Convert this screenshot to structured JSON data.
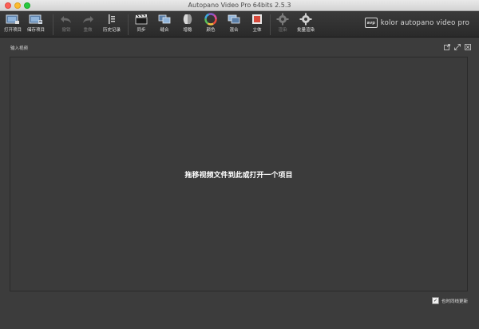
{
  "window": {
    "title": "Autopano Video Pro 64bits 2.5.3"
  },
  "toolbar": {
    "items": [
      {
        "id": "open",
        "label": "打开项目",
        "icon": "open-project-icon",
        "enabled": true
      },
      {
        "id": "save",
        "label": "储存项目",
        "icon": "save-project-icon",
        "enabled": true
      },
      {
        "id": "undo",
        "label": "撤销",
        "icon": "undo-icon",
        "enabled": false
      },
      {
        "id": "redo",
        "label": "重做",
        "icon": "redo-icon",
        "enabled": false
      },
      {
        "id": "history",
        "label": "历史记录",
        "icon": "history-icon",
        "enabled": true
      },
      {
        "id": "sync",
        "label": "同步",
        "icon": "clapper-icon",
        "enabled": true
      },
      {
        "id": "stitch",
        "label": "缝合",
        "icon": "stitch-icon",
        "enabled": true
      },
      {
        "id": "stabilize",
        "label": "增稳",
        "icon": "stabilize-icon",
        "enabled": true
      },
      {
        "id": "color",
        "label": "颜色",
        "icon": "color-wheel-icon",
        "enabled": true
      },
      {
        "id": "blend",
        "label": "混合",
        "icon": "blend-icon",
        "enabled": true
      },
      {
        "id": "stereo",
        "label": "立体",
        "icon": "stereo-icon",
        "enabled": true
      },
      {
        "id": "render",
        "label": "渲染",
        "icon": "gear-icon",
        "enabled": false
      },
      {
        "id": "batch",
        "label": "批量渲染",
        "icon": "batch-gear-icon",
        "enabled": true
      }
    ]
  },
  "brand": {
    "logo_text": "avp",
    "name": "kolor autopano video pro"
  },
  "panel": {
    "title": "输入视频",
    "drop_hint": "拖移视频文件到此或打开一个项目",
    "icons": [
      "external-link-icon",
      "expand-icon",
      "close-icon"
    ]
  },
  "auto_update": {
    "label": "也时同线更新",
    "checked": true,
    "check_glyph": "✓"
  }
}
